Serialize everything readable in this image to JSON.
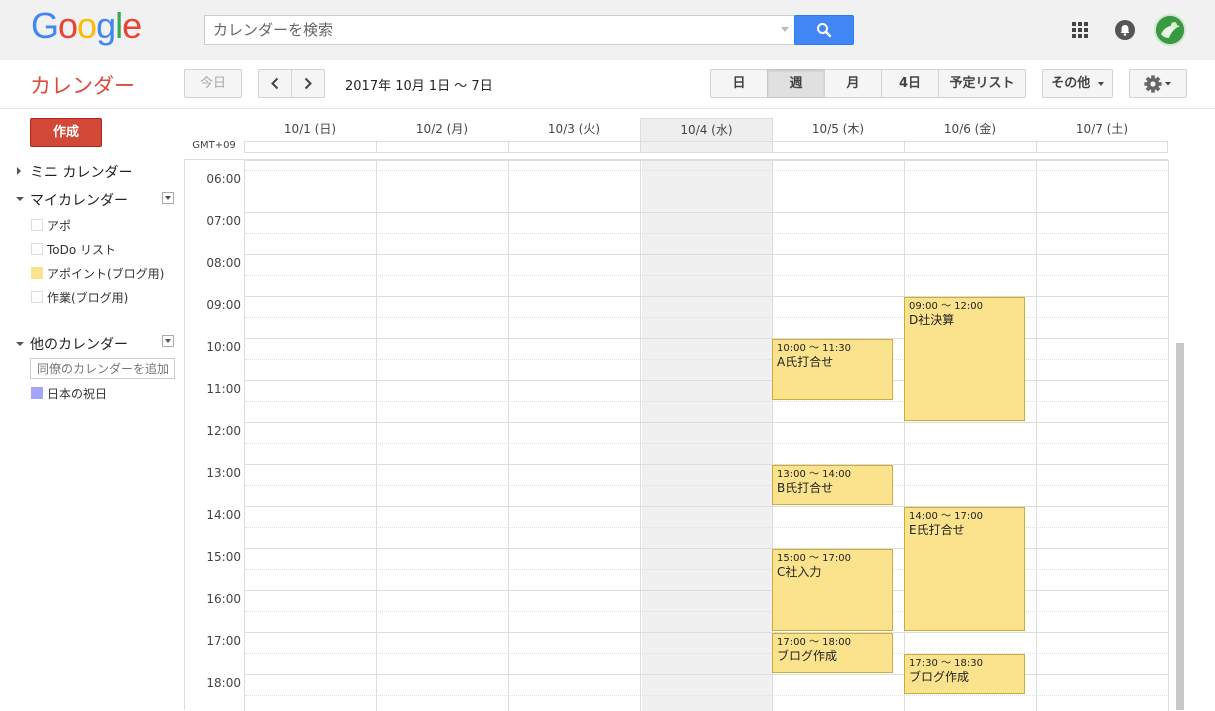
{
  "google_logo": [
    "G",
    "o",
    "o",
    "g",
    "l",
    "e"
  ],
  "colors": {
    "logo": [
      "#4285f4",
      "#ea4335",
      "#fbbc05",
      "#4285f4",
      "#34a853",
      "#ea4335"
    ],
    "accent": "#dd4b39",
    "create_button": "#d14836",
    "search_button": "#4285f4",
    "event": "#fbe38d",
    "appointments_calendar": "#fbe38d",
    "holiday_calendar": "#a4a4ff"
  },
  "search": {
    "placeholder": "カレンダーを検索",
    "button_icon": "search-icon"
  },
  "app_title": "カレンダー",
  "toolbar": {
    "today": "今日",
    "date_range": "2017年 10月 1日 ～ 7日",
    "views": [
      "日",
      "週",
      "月",
      "4日",
      "予定リスト"
    ],
    "selected_view": "週",
    "more": "その他",
    "settings_icon": "gear-icon"
  },
  "sidebar": {
    "create": "作成",
    "mini_calendar": "ミニ カレンダー",
    "my_calendars": {
      "title": "マイカレンダー",
      "items": [
        {
          "label": "アポ",
          "color": ""
        },
        {
          "label": "ToDo リスト",
          "color": ""
        },
        {
          "label": "アポイント(ブログ用)",
          "color": "#fbe38d"
        },
        {
          "label": "作業(ブログ用)",
          "color": ""
        }
      ]
    },
    "other_calendars": {
      "title": "他のカレンダー",
      "input_placeholder": "同僚のカレンダーを追加",
      "items": [
        {
          "label": "日本の祝日",
          "color": "#a4a4ff"
        }
      ]
    }
  },
  "timezone": "GMT+09",
  "days": [
    "10/1 (日)",
    "10/2 (月)",
    "10/3 (火)",
    "10/4 (水)",
    "10/5 (木)",
    "10/6 (金)",
    "10/7 (土)"
  ],
  "today_index": 3,
  "hours": [
    "06:00",
    "07:00",
    "08:00",
    "09:00",
    "10:00",
    "11:00",
    "12:00",
    "13:00",
    "14:00",
    "15:00",
    "16:00",
    "17:00",
    "18:00"
  ],
  "events": [
    {
      "day": 4,
      "start": 10.0,
      "end": 11.5,
      "time": "10:00 ～ 11:30",
      "title": "A氏打合せ"
    },
    {
      "day": 4,
      "start": 13.0,
      "end": 14.0,
      "time": "13:00 ～ 14:00",
      "title": "B氏打合せ"
    },
    {
      "day": 4,
      "start": 15.0,
      "end": 17.0,
      "time": "15:00 ～ 17:00",
      "title": "C社入力"
    },
    {
      "day": 4,
      "start": 17.0,
      "end": 18.0,
      "time": "17:00 ～ 18:00",
      "title": "ブログ作成"
    },
    {
      "day": 5,
      "start": 9.0,
      "end": 12.0,
      "time": "09:00 ～ 12:00",
      "title": "D社決算"
    },
    {
      "day": 5,
      "start": 14.0,
      "end": 17.0,
      "time": "14:00 ～ 17:00",
      "title": "E氏打合せ"
    },
    {
      "day": 5,
      "start": 17.5,
      "end": 18.5,
      "time": "17:30 ～ 18:30",
      "title": "ブログ作成"
    }
  ]
}
